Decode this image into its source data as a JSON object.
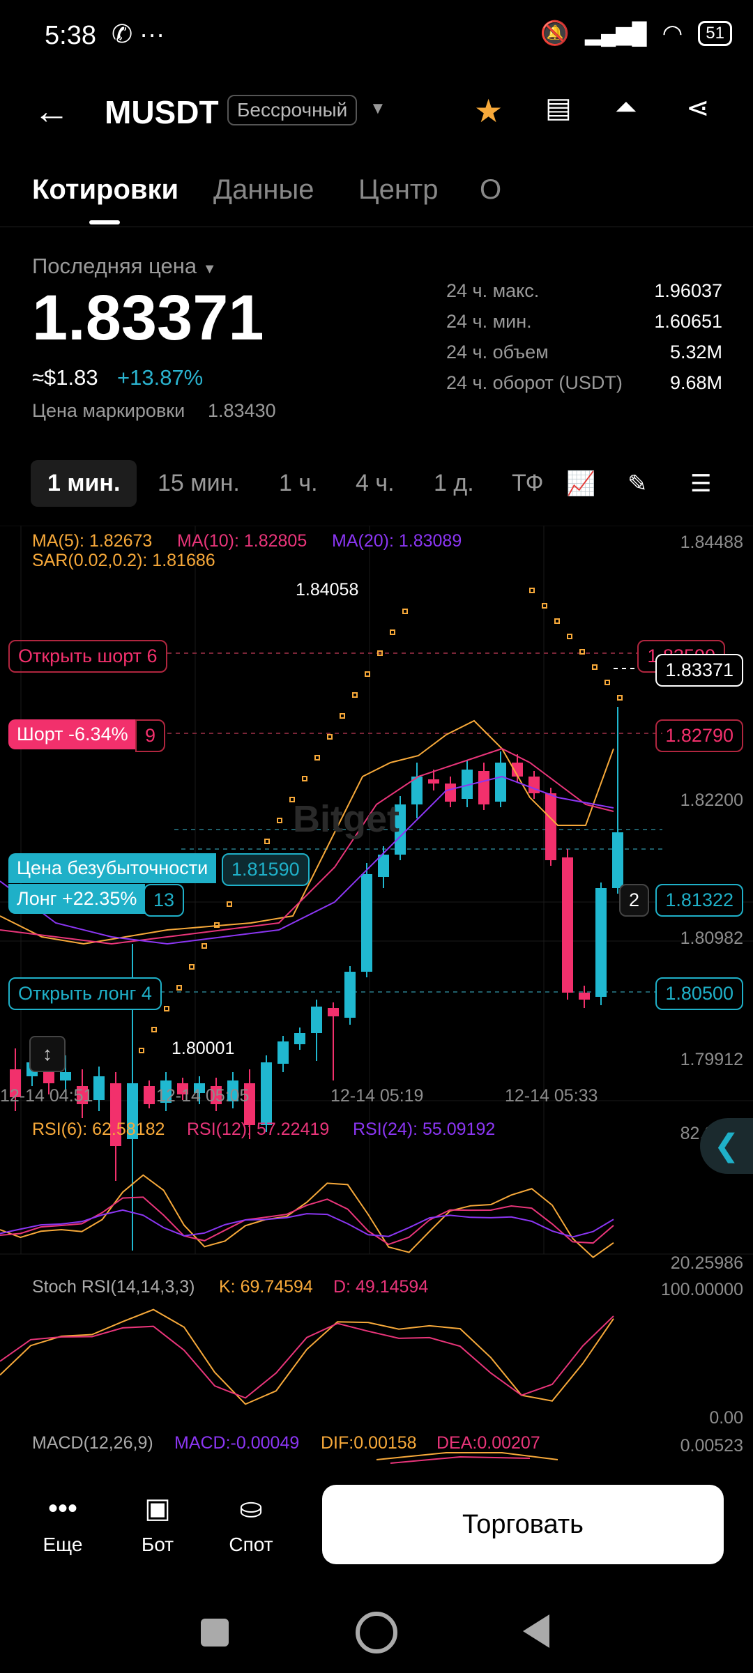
{
  "status_bar": {
    "time": "5:38",
    "misc": "✆ ···",
    "battery": "51"
  },
  "header": {
    "symbol": "MUSDT",
    "contract_type": "Бессрочный"
  },
  "tabs": [
    "Котировки",
    "Данные",
    "Центр",
    "О"
  ],
  "price_section": {
    "last_price_label": "Последняя цена",
    "last_price": "1.83371",
    "usd_equiv": "≈$1.83",
    "change": "+13.87%",
    "mark_label": "Цена маркировки",
    "mark_value": "1.83430",
    "stats": [
      {
        "label": "24 ч. макс.",
        "value": "1.96037"
      },
      {
        "label": "24 ч. мин.",
        "value": "1.60651"
      },
      {
        "label": "24 ч. объем",
        "value": "5.32M"
      },
      {
        "label": "24 ч. оборот (USDT)",
        "value": "9.68M"
      }
    ]
  },
  "intervals": [
    "1 мин.",
    "15 мин.",
    "1 ч.",
    "4 ч.",
    "1 д.",
    "ТФ"
  ],
  "chart": {
    "ma_legend": {
      "ma5": "MA(5): 1.82673",
      "ma10": "MA(10): 1.82805",
      "ma20": "MA(20): 1.83089",
      "sar": "SAR(0.02,0.2): 1.81686"
    },
    "price_axis": [
      "1.84488",
      "1.82200",
      "1.80982",
      "1.79912"
    ],
    "high_label": "1.84058",
    "low_label": "1.80001",
    "watermark": "Bitget",
    "orders": {
      "open_short": "Открыть шорт 6",
      "open_short_price": "1.83590",
      "short": "Шорт -6.34%",
      "short_qty": "9",
      "short_price": "1.82790",
      "breakeven": "Цена безубыточности",
      "breakeven_price": "1.81590",
      "long": "Лонг +22.35%",
      "long_qty": "13",
      "long_count": "2",
      "long_price": "1.81322",
      "open_long": "Открыть лонг 4",
      "open_long_price": "1.80500"
    },
    "current_price_tag": "1.83371",
    "time_axis": [
      "12-14 04:51",
      "12-14 05:05",
      "12-14 05:19",
      "12-14 05:33"
    ],
    "rsi": {
      "r6": "RSI(6): 62.58182",
      "r12": "RSI(12): 57.22419",
      "r24": "RSI(24): 55.09192",
      "axis_top": "82.2732",
      "axis_bottom": "20.25986"
    },
    "stoch": {
      "name": "Stoch RSI(14,14,3,3)",
      "k": "K: 69.74594",
      "d": "D: 49.14594",
      "axis_top": "100.00000",
      "axis_bottom": "0.00"
    },
    "macd": {
      "name": "MACD(12,26,9)",
      "macd": "MACD:-0.00049",
      "dif": "DIF:0.00158",
      "dea": "DEA:0.00207",
      "axis_top": "0.00523"
    },
    "colors": {
      "up": "#20b8d0",
      "down": "#f2306c",
      "ma5": "#f7a93a",
      "ma10": "#e9357a",
      "ma20": "#8b36f3",
      "sar": "#f7a93a"
    }
  },
  "bottom_nav": {
    "more": "Еще",
    "bot": "Бот",
    "spot": "Спот",
    "trade": "Торговать"
  }
}
